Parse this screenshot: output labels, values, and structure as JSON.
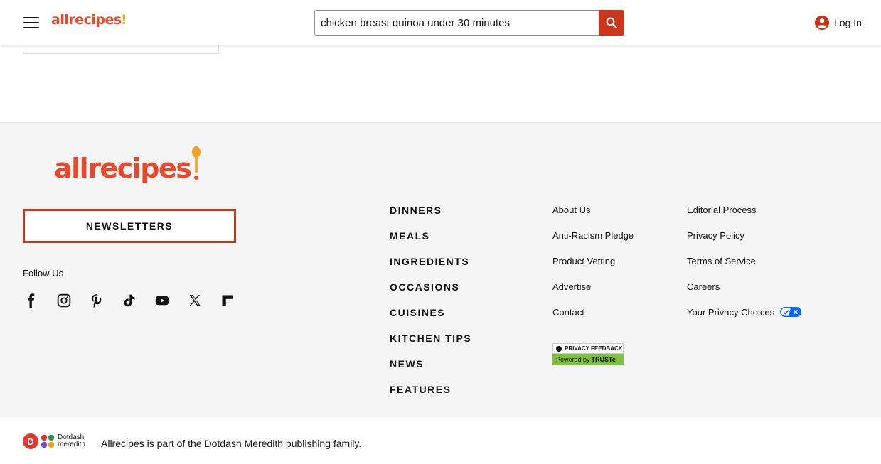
{
  "header": {
    "logo": "allrecipes",
    "menu_icon": "hamburger-menu-icon",
    "search": {
      "value": "chicken breast quinoa under 30 minutes",
      "button_icon": "search-icon"
    },
    "login_label": "Log In",
    "login_icon": "account-circle-icon"
  },
  "footer": {
    "logo": "allrecipes",
    "newsletters_label": "NEWSLETTERS",
    "follow_label": "Follow Us",
    "social_icons": [
      "facebook-icon",
      "instagram-icon",
      "pinterest-icon",
      "tiktok-icon",
      "youtube-icon",
      "x-icon",
      "flipboard-icon"
    ],
    "categories": [
      "DINNERS",
      "MEALS",
      "INGREDIENTS",
      "OCCASIONS",
      "CUISINES",
      "KITCHEN TIPS",
      "NEWS",
      "FEATURES"
    ],
    "links_col1": [
      "About Us",
      "Anti-Racism Pledge",
      "Product Vetting",
      "Advertise",
      "Contact"
    ],
    "links_col2": [
      "Editorial Process",
      "Privacy Policy",
      "Terms of Service",
      "Careers",
      "Your Privacy Choices"
    ],
    "truste": {
      "top": "PRIVACY FEEDBACK",
      "bottom_prefix": "Powered by",
      "bottom_brand": "TRUSTe"
    }
  },
  "bottom_bar": {
    "brand_line1": "Dotdash",
    "brand_line2": "meredith",
    "badge_letter": "D",
    "statement_before": "Allrecipes is part of the",
    "statement_link": "Dotdash Meredith",
    "statement_after": "publishing family."
  },
  "colors": {
    "brand_orange": "#e8492a",
    "accent_red": "#c9371d",
    "spoon_yellow": "#f0a324",
    "privacy_toggle_blue": "#0066ff",
    "truste_green": "#7ec13d"
  }
}
